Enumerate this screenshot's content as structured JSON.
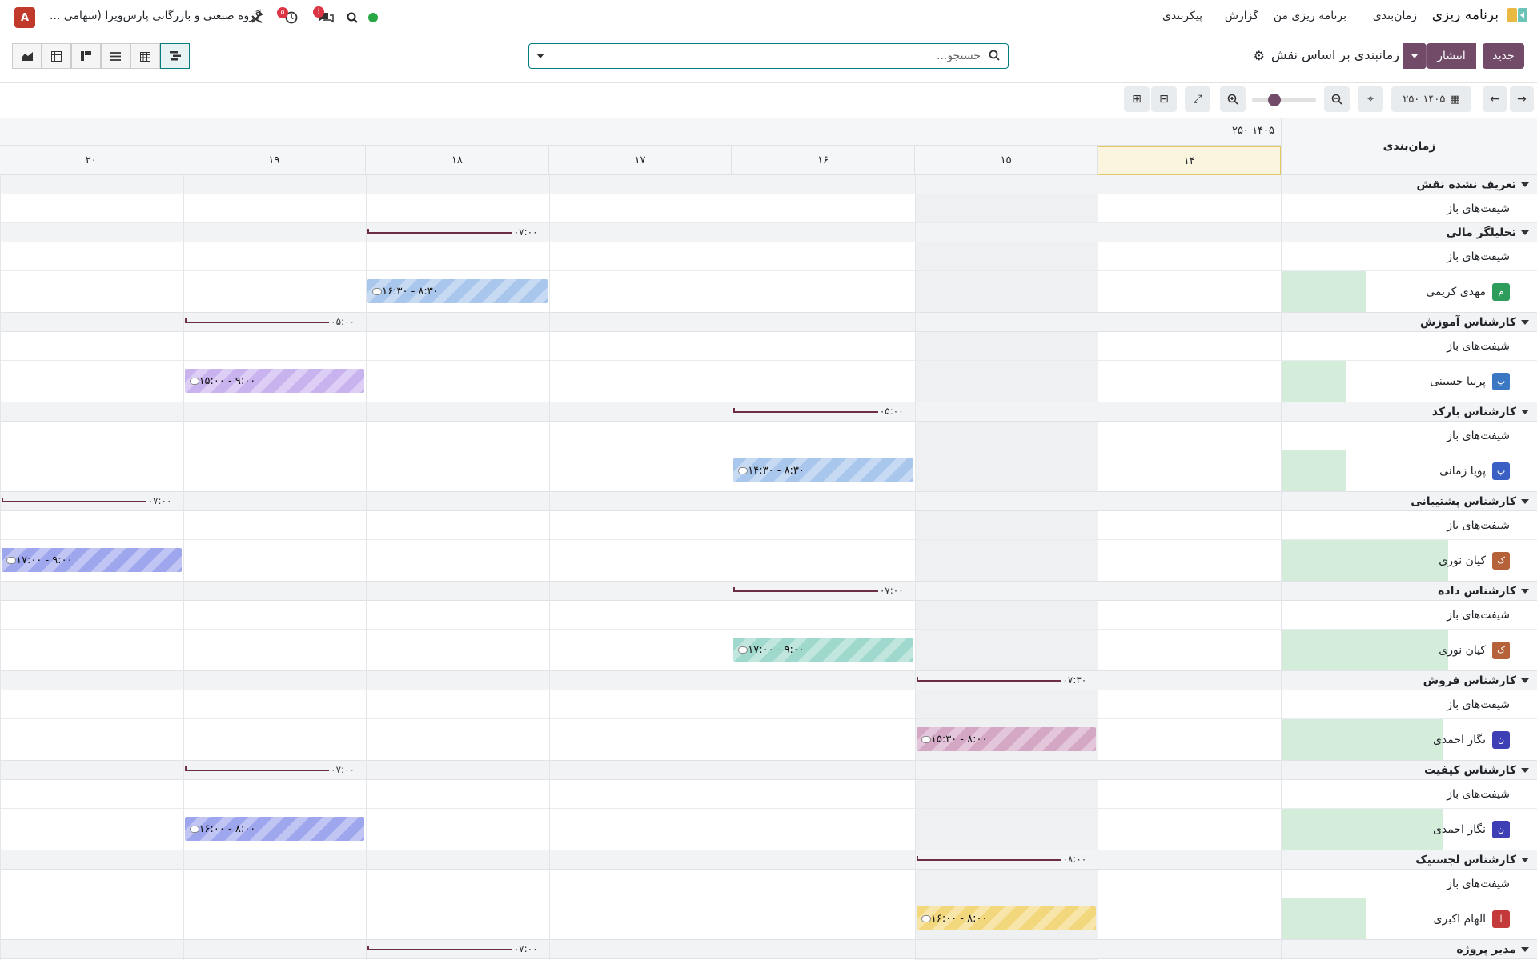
{
  "navbar": {
    "app_name": "برنامه ریزی",
    "menu": [
      "زمان‌بندی",
      "برنامه ریزی من",
      "گزارش",
      "پیکربندی"
    ],
    "company": "گروه صنعتی و بازرگانی پارس‌ویرا (سهامی ...",
    "user_initial": "A",
    "activity_count": "۵",
    "message_count": "!"
  },
  "control": {
    "new_label": "جدید",
    "publish_label": "انتشار",
    "view_title": "زمانبندی بر اساس نقش",
    "search_placeholder": "جستجو..."
  },
  "toolbar": {
    "period_label": "۱۴۰۵ ۲۵۰"
  },
  "gantt": {
    "title": "زمان‌بندی",
    "month_label": "۱۴۰۵ ۲۵۰",
    "days": [
      "۱۴",
      "۱۵",
      "۱۶",
      "۱۷",
      "۱۸",
      "۱۹",
      "۲۰"
    ],
    "open_shifts_label": "شیفت‌های باز",
    "groups": [
      {
        "name": "تعریف نشده نقش",
        "open": "",
        "open_day": -1,
        "resources": []
      },
      {
        "name": "تحلیلگر مالی",
        "open": "۰۷:۰۰",
        "open_day": 4,
        "resources": [
          {
            "name": "مهدی کریمی",
            "initial": "م",
            "avatar": "#2e9d5b",
            "progress": 0.33,
            "shift": "۸:۳۰ - ۱۶:۳۰",
            "day": 4,
            "color": "blue"
          }
        ]
      },
      {
        "name": "کارشناس آموزش",
        "open": "۰۵:۰۰",
        "open_day": 5,
        "resources": [
          {
            "name": "پرنیا حسینی",
            "initial": "پ",
            "avatar": "#3a78c4",
            "progress": 0.25,
            "shift": "۹:۰۰ - ۱۵:۰۰",
            "day": 5,
            "color": "purple"
          }
        ]
      },
      {
        "name": "کارشناس بارکد",
        "open": "۰۵:۰۰",
        "open_day": 2,
        "resources": [
          {
            "name": "پویا زمانی",
            "initial": "پ",
            "avatar": "#3a5fc4",
            "progress": 0.25,
            "shift": "۸:۳۰ - ۱۴:۳۰",
            "day": 2,
            "color": "blue"
          }
        ]
      },
      {
        "name": "کارشناس پشتیبانی",
        "open": "۰۷:۰۰",
        "open_day": 6,
        "resources": [
          {
            "name": "کیان نوری",
            "initial": "ک",
            "avatar": "#b5613a",
            "progress": 0.65,
            "shift": "۹:۰۰ - ۱۷:۰۰",
            "day": 6,
            "color": "indigo"
          }
        ]
      },
      {
        "name": "کارشناس داده",
        "open": "۰۷:۰۰",
        "open_day": 2,
        "resources": [
          {
            "name": "کیان نوری",
            "initial": "ک",
            "avatar": "#b5613a",
            "progress": 0.65,
            "shift": "۹:۰۰ - ۱۷:۰۰",
            "day": 2,
            "color": "teal"
          }
        ]
      },
      {
        "name": "کارشناس فروش",
        "open": "۰۷:۳۰",
        "open_day": 1,
        "resources": [
          {
            "name": "نگار احمدی",
            "initial": "ن",
            "avatar": "#3f3fb5",
            "progress": 0.63,
            "shift": "۸:۰۰ - ۱۵:۳۰",
            "day": 1,
            "color": "mauve"
          }
        ]
      },
      {
        "name": "کارشناس کیفیت",
        "open": "۰۷:۰۰",
        "open_day": 5,
        "resources": [
          {
            "name": "نگار احمدی",
            "initial": "ن",
            "avatar": "#3f3fb5",
            "progress": 0.63,
            "shift": "۸:۰۰ - ۱۶:۰۰",
            "day": 5,
            "color": "indigo"
          }
        ]
      },
      {
        "name": "کارشناس لجستیک",
        "open": "۰۸:۰۰",
        "open_day": 1,
        "resources": [
          {
            "name": "الهام اکبری",
            "initial": "ا",
            "avatar": "#c43a3a",
            "progress": 0.33,
            "shift": "۸:۰۰ - ۱۶:۰۰",
            "day": 1,
            "color": "yellow"
          }
        ]
      },
      {
        "name": "مدیر پروژه",
        "open": "۰۷:۰۰",
        "open_day": 4,
        "resources": []
      }
    ]
  },
  "colors": {
    "primary": "#714b67",
    "teal_accent": "#017e84",
    "blue": "#a9c6ec",
    "purple": "#c9b3ee",
    "indigo": "#9ea6ee",
    "teal": "#9fd8cd",
    "mauve": "#d4a8c4",
    "yellow": "#f2d77d"
  }
}
